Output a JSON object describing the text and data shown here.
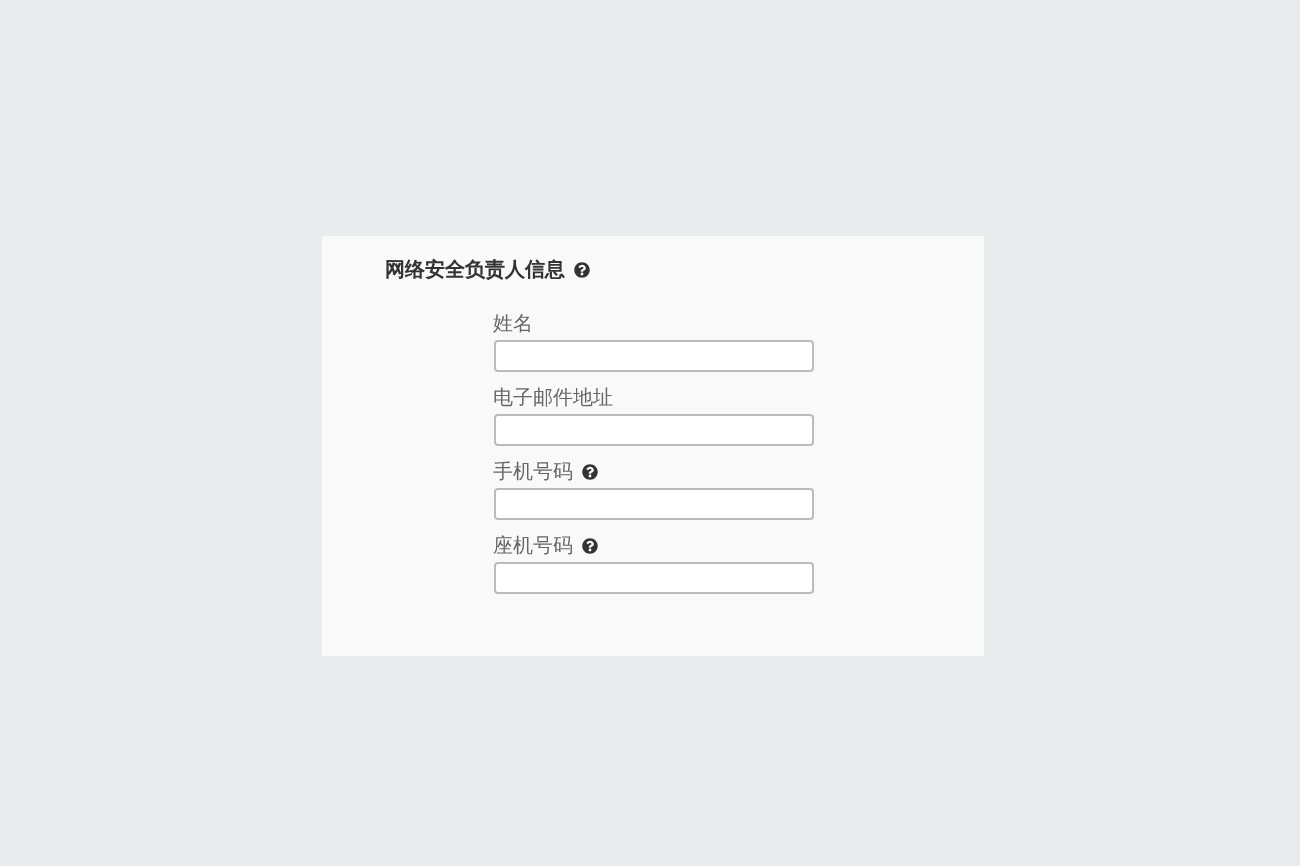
{
  "section": {
    "title": "网络安全负责人信息",
    "help": true
  },
  "fields": [
    {
      "label": "姓名",
      "help": false
    },
    {
      "label": "电子邮件地址",
      "help": false
    },
    {
      "label": "手机号码",
      "help": true
    },
    {
      "label": "座机号码",
      "help": true
    }
  ]
}
